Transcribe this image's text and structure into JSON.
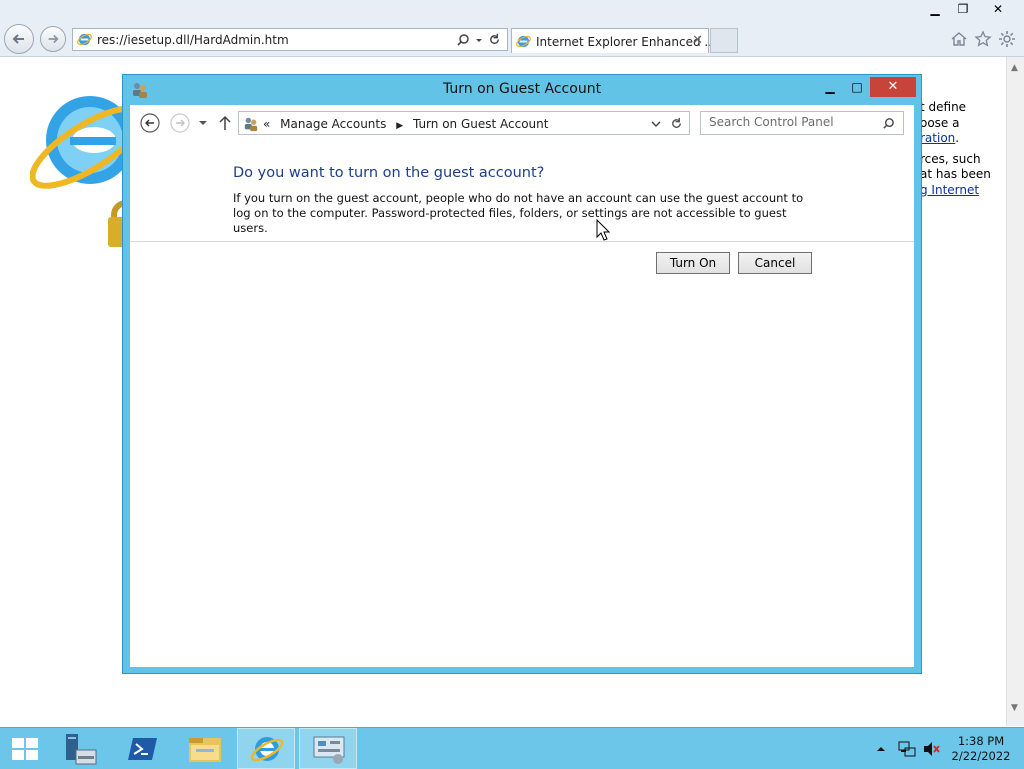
{
  "browser": {
    "address_url": "res://iesetup.dll/HardAdmin.htm",
    "tab_title": "Internet Explorer Enhanced ...",
    "tab_close": "✕",
    "window_controls": {
      "minimize": "▁",
      "restore": "❐",
      "close": "✕"
    },
    "page_text": {
      "line1": "t define",
      "line2": "oose a",
      "line3_link": "ration",
      "line3_tail": ".",
      "line4": "rces, such",
      "line5": "at has been",
      "line6_link": "g Internet"
    }
  },
  "dialog": {
    "title": "Turn on Guest Account",
    "controls": {
      "minimize": "▁",
      "maximize": "□",
      "close": "✕"
    },
    "breadcrumb": {
      "prefix": "«",
      "items": [
        "Manage Accounts",
        "Turn on Guest Account"
      ]
    },
    "search_placeholder": "Search Control Panel",
    "heading": "Do you want to turn on the guest account?",
    "body": "If you turn on the guest account, people who do not have an account can use the guest account to log on to the computer. Password-protected files, folders, or settings are not accessible to guest users.",
    "buttons": {
      "primary": "Turn On",
      "secondary": "Cancel"
    }
  },
  "taskbar": {
    "items": [
      {
        "icon": "windows-start-icon"
      },
      {
        "icon": "server-manager-icon"
      },
      {
        "icon": "powershell-icon"
      },
      {
        "icon": "file-explorer-icon"
      },
      {
        "icon": "internet-explorer-icon",
        "active": true
      },
      {
        "icon": "control-panel-icon",
        "active": true
      }
    ],
    "clock": {
      "time": "1:38 PM",
      "date": "2/22/2022"
    }
  },
  "colors": {
    "dialog_frame": "#63c3e7",
    "taskbar": "#6bc6e9",
    "heading_blue": "#1e3f87",
    "close_red": "#c7443b"
  }
}
